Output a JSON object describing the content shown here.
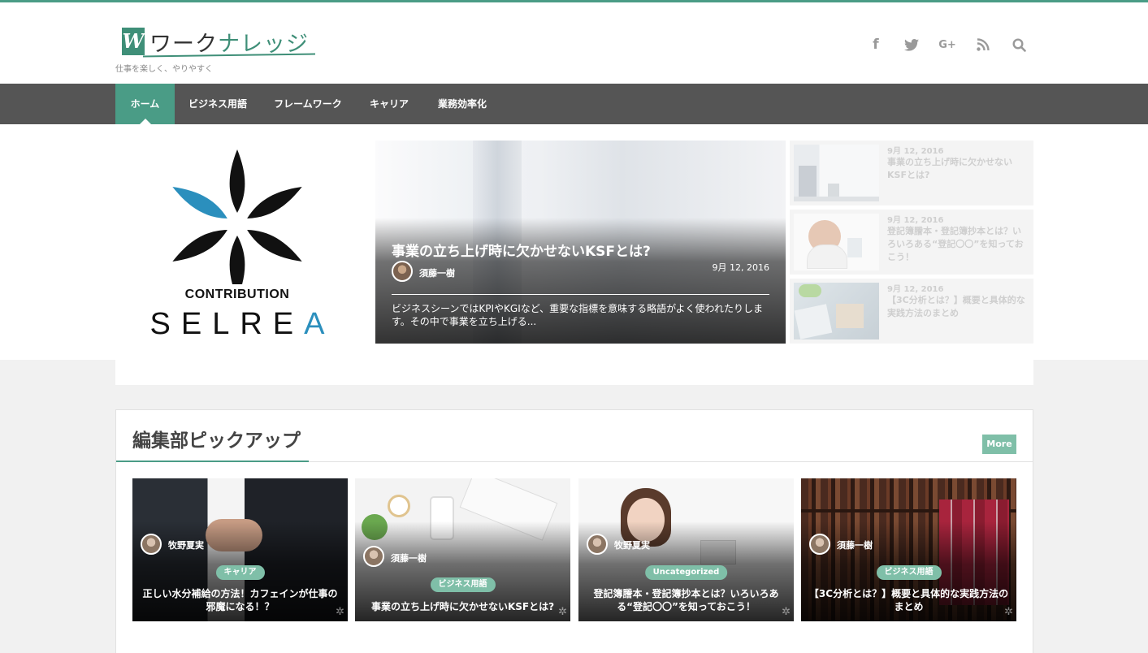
{
  "site": {
    "logo_mark": "W",
    "logo_text_a": "ワーク",
    "logo_text_b": "ナレッジ",
    "tagline": "仕事を楽しく、やりやすく"
  },
  "social": [
    {
      "name": "facebook-icon",
      "glyph": "f"
    },
    {
      "name": "twitter-icon",
      "glyph": "🐦"
    },
    {
      "name": "google-plus-icon",
      "glyph": "G+"
    },
    {
      "name": "rss-icon",
      "glyph": "◝"
    },
    {
      "name": "search-icon",
      "glyph": "⚲"
    }
  ],
  "nav": {
    "items": [
      "ホーム",
      "ビジネス用語",
      "フレームワーク",
      "キャリア",
      "業務効率化"
    ],
    "active": "ホーム"
  },
  "brand": {
    "sub": "CONTRIBUTION",
    "name_main": "SELRE",
    "name_accent": "A"
  },
  "featured": {
    "title": "事業の立ち上げ時に欠かせないKSFとは?",
    "author": "須藤一樹",
    "date": "9月 12, 2016",
    "excerpt": "ビジネスシーンではKPIやKGIなど、重要な指標を意味する略語がよく使われたりします。その中で事業を立ち上げる..."
  },
  "side_posts": [
    {
      "date": "9月 12, 2016",
      "title": "事業の立ち上げ時に欠かせないKSFとは?"
    },
    {
      "date": "9月 12, 2016",
      "title": "登記簿謄本・登記簿抄本とは？いろいろある“登記〇〇”を知っておこう！"
    },
    {
      "date": "9月 12, 2016",
      "title": "【3C分析とは？】概要と具体的な実践方法のまとめ"
    }
  ],
  "pickup": {
    "heading": "編集部ピックアップ",
    "more_label": "More",
    "cards": [
      {
        "author": "牧野夏実",
        "category": "キャリア",
        "title": "正しい水分補給の方法！カフェインが仕事の邪魔になる！？"
      },
      {
        "author": "須藤一樹",
        "category": "ビジネス用語",
        "title": "事業の立ち上げ時に欠かせないKSFとは?"
      },
      {
        "author": "牧野夏実",
        "category": "Uncategorized",
        "title": "登記簿謄本・登記簿抄本とは？いろいろある“登記〇〇”を知っておこう！"
      },
      {
        "author": "須藤一樹",
        "category": "ビジネス用語",
        "title": "【3C分析とは？】概要と具体的な実践方法のまとめ"
      }
    ]
  },
  "colors": {
    "accent": "#4a9c86",
    "nav_bg": "#555555",
    "badge": "#7fbfa8",
    "brand_blue": "#2b8fbd"
  }
}
